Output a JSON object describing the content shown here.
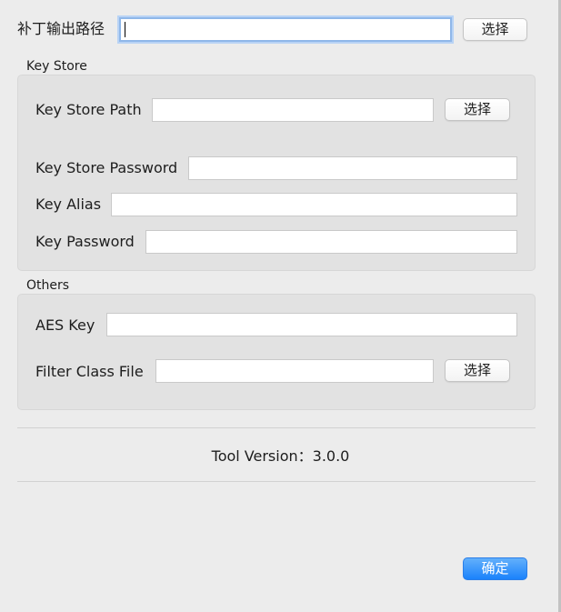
{
  "patch": {
    "label": "补丁输出路径",
    "value": "",
    "choose_label": "选择"
  },
  "key_store": {
    "group_title": "Key Store",
    "path_label": "Key Store Path",
    "path_value": "",
    "path_choose_label": "选择",
    "password_label": "Key Store Password",
    "password_value": "",
    "alias_label": "Key Alias",
    "alias_value": "",
    "key_password_label": "Key Password",
    "key_password_value": ""
  },
  "others": {
    "group_title": "Others",
    "aes_label": "AES Key",
    "aes_value": "",
    "filter_label": "Filter Class File",
    "filter_value": "",
    "filter_choose_label": "选择"
  },
  "version": {
    "text": "Tool Version：3.0.0"
  },
  "confirm_label": "确定",
  "colors": {
    "accent": "#1a82fb",
    "window_bg": "#ececec",
    "group_bg": "#e2e2e2"
  }
}
